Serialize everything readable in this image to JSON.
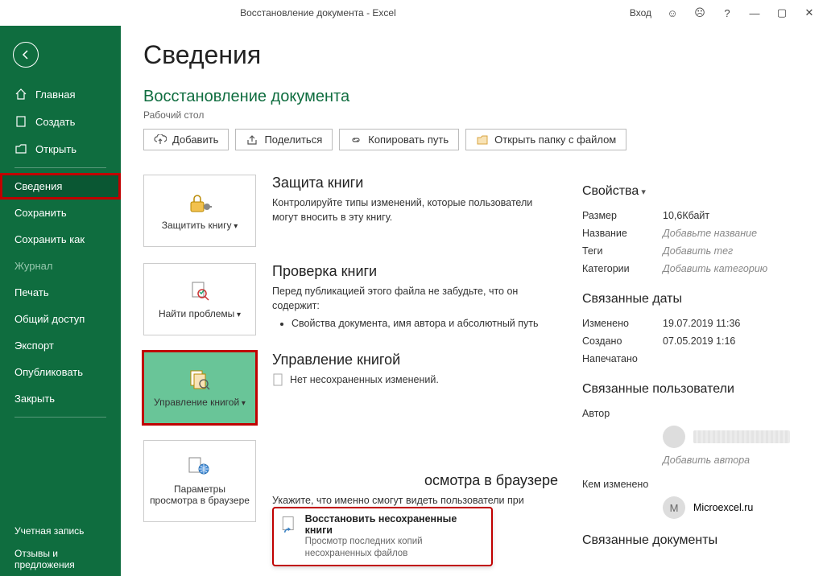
{
  "titlebar": {
    "title": "Восстановление документа  -  Excel",
    "signin": "Вход"
  },
  "sidebar": {
    "home": "Главная",
    "new": "Создать",
    "open": "Открыть",
    "info": "Сведения",
    "save": "Сохранить",
    "saveas": "Сохранить как",
    "history": "Журнал",
    "print": "Печать",
    "share": "Общий доступ",
    "export": "Экспорт",
    "publish": "Опубликовать",
    "close": "Закрыть",
    "account": "Учетная запись",
    "feedback": "Отзывы и предложения"
  },
  "page": {
    "heading": "Сведения",
    "doc_title": "Восстановление документа",
    "location": "Рабочий стол"
  },
  "toolbar": {
    "upload": "Добавить",
    "share": "Поделиться",
    "copypath": "Копировать путь",
    "openfolder": "Открыть папку с файлом"
  },
  "sections": {
    "protect": {
      "tile": "Защитить книгу",
      "title": "Защита книги",
      "desc": "Контролируйте типы изменений, которые пользователи могут вносить в эту книгу."
    },
    "inspect": {
      "tile": "Найти проблемы",
      "title": "Проверка книги",
      "desc": "Перед публикацией этого файла не забудьте, что он содержит:",
      "bullet": "Свойства документа, имя автора и абсолютный путь"
    },
    "manage": {
      "tile": "Управление книгой",
      "title": "Управление книгой",
      "none": "Нет несохраненных изменений."
    },
    "browser": {
      "tile": "Параметры просмотра в браузере",
      "title_fragment": "осмотра в браузере",
      "desc": "Укажите, что именно смогут видеть пользователи при просмотре этой книги в Интернете."
    }
  },
  "popup": {
    "title": "Восстановить несохраненные книги",
    "sub": "Просмотр последних копий несохраненных файлов"
  },
  "props": {
    "group": "Свойства",
    "size_label": "Размер",
    "size": "10,6Кбайт",
    "title_label": "Название",
    "title_ph": "Добавьте название",
    "tags_label": "Теги",
    "tags_ph": "Добавить тег",
    "cat_label": "Категории",
    "cat_ph": "Добавить категорию"
  },
  "dates": {
    "group": "Связанные даты",
    "modified_label": "Изменено",
    "modified": "19.07.2019 11:36",
    "created_label": "Создано",
    "created": "07.05.2019 1:16",
    "printed_label": "Напечатано"
  },
  "users": {
    "group": "Связанные пользователи",
    "author_label": "Автор",
    "add_author": "Добавить автора",
    "changed_label": "Кем изменено",
    "changed_by": "Microexcel.ru",
    "changed_initial": "M"
  },
  "docs": {
    "group": "Связанные документы"
  }
}
